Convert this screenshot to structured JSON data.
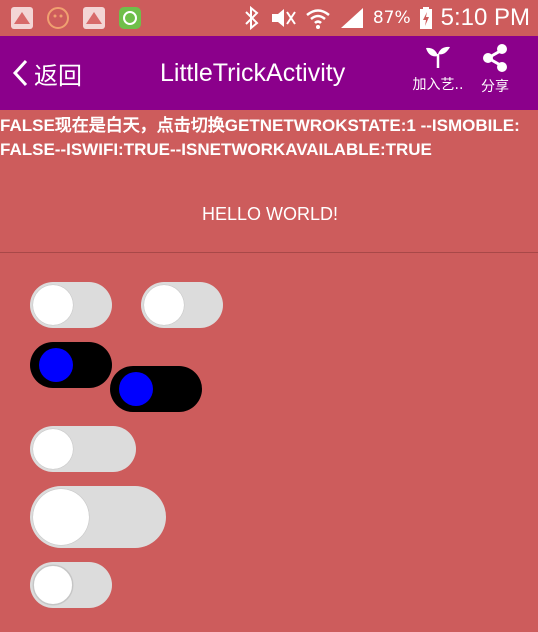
{
  "status_bar": {
    "battery_percent": "87%",
    "time": "5:10 PM"
  },
  "toolbar": {
    "back_label": "返回",
    "title": "LittleTrickActivity",
    "join_label": "加入艺..",
    "share_label": "分享"
  },
  "content": {
    "info_text": "FALSE现在是白天，点击切换GETNETWROKSTATE:1 --ISMOBILE:FALSE--ISWIFI:TRUE--ISNETWORKAVAILABLE:TRUE",
    "hello": "HELLO WORLD!"
  },
  "switches": [
    {
      "name": "switch-1",
      "checked": false
    },
    {
      "name": "switch-2",
      "checked": false
    },
    {
      "name": "switch-3",
      "checked": false
    },
    {
      "name": "switch-4",
      "checked": false
    },
    {
      "name": "switch-5",
      "checked": false
    },
    {
      "name": "switch-6",
      "checked": false
    },
    {
      "name": "switch-7",
      "checked": false
    }
  ],
  "colors": {
    "background": "#cd5c5c",
    "toolbar": "#8b008b",
    "switch_track": "#dcdcdc",
    "switch_thumb": "#ffffff",
    "dark_switch_track": "#000000",
    "dark_switch_thumb": "#0000ff"
  },
  "icons": [
    "notification-icon-1",
    "notification-icon-2",
    "notification-icon-3",
    "notification-icon-4",
    "bluetooth-icon",
    "mute-icon",
    "wifi-icon",
    "signal-icon",
    "battery-icon",
    "back-arrow-icon",
    "sprout-icon",
    "share-icon"
  ]
}
